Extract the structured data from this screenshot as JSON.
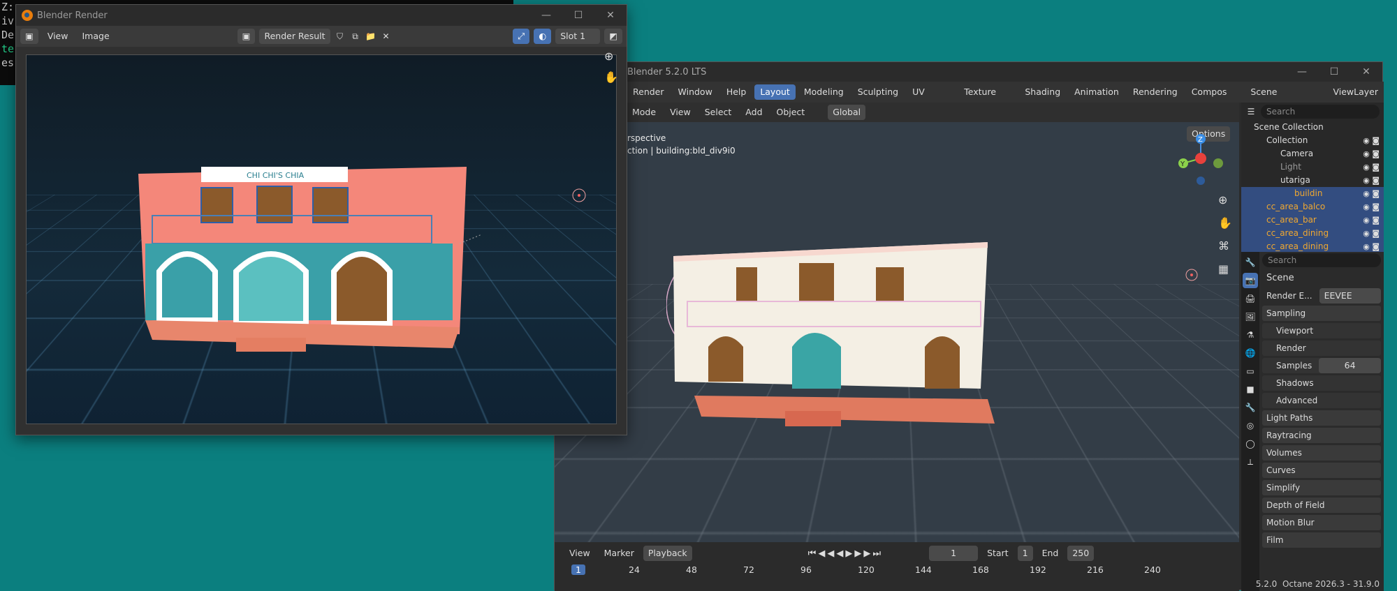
{
  "terminal": {
    "lines": [
      "Z:",
      "iv",
      "De",
      "te",
      "es"
    ]
  },
  "render_window": {
    "title": "Blender Render",
    "menu": [
      "View",
      "Image"
    ],
    "image_name": "Render Result",
    "slot": "Slot 1",
    "sign_text": "CHI CHI'S CHIA"
  },
  "main_window": {
    "title": "Blender 5.2.0 LTS",
    "menus": [
      "Render",
      "Window",
      "Help"
    ],
    "workspaces": [
      "Layout",
      "Modeling",
      "Sculpting",
      "UV Editing",
      "Texture Paint",
      "Shading",
      "Animation",
      "Rendering",
      "Compos"
    ],
    "scene": "Scene",
    "view_layer": "ViewLayer",
    "viewport_header": {
      "mode": "Mode",
      "menus": [
        "View",
        "Select",
        "Add",
        "Object"
      ],
      "orientation": "Global",
      "options": "Options"
    },
    "overlay_text": {
      "line1": "rspective",
      "line2": "ction | building:bld_div9i0"
    },
    "timeline": {
      "menus": [
        "View",
        "Marker",
        "Playback"
      ],
      "current": "1",
      "start_label": "Start",
      "start": "1",
      "end_label": "End",
      "end": "250",
      "ticks": [
        "1",
        "24",
        "48",
        "72",
        "96",
        "120",
        "144",
        "168",
        "192",
        "216",
        "240"
      ]
    }
  },
  "outliner": {
    "search_placeholder": "Search",
    "items": [
      {
        "label": "Scene Collection"
      },
      {
        "label": "Collection"
      },
      {
        "label": "Camera"
      },
      {
        "label": "Light"
      },
      {
        "label": "utariga"
      },
      {
        "label": "buildin"
      },
      {
        "label": "cc_area_balco"
      },
      {
        "label": "cc_area_bar"
      },
      {
        "label": "cc_area_dining"
      },
      {
        "label": "cc_area_dining"
      }
    ]
  },
  "properties": {
    "search_placeholder": "Search",
    "context": "Scene",
    "render_engine_label": "Render E...",
    "render_engine": "EEVEE",
    "sections": {
      "sampling": "Sampling",
      "viewport": "Viewport",
      "render": "Render",
      "samples_label": "Samples",
      "samples": "64",
      "shadows": "Shadows",
      "advanced": "Advanced",
      "light_paths": "Light Paths",
      "raytracing": "Raytracing",
      "volumes": "Volumes",
      "curves": "Curves",
      "simplify": "Simplify",
      "dof": "Depth of Field",
      "motion_blur": "Motion Blur",
      "film": "Film"
    }
  },
  "status": {
    "version": "5.2.0",
    "octane": "Octane 2026.3 - 31.9.0"
  }
}
